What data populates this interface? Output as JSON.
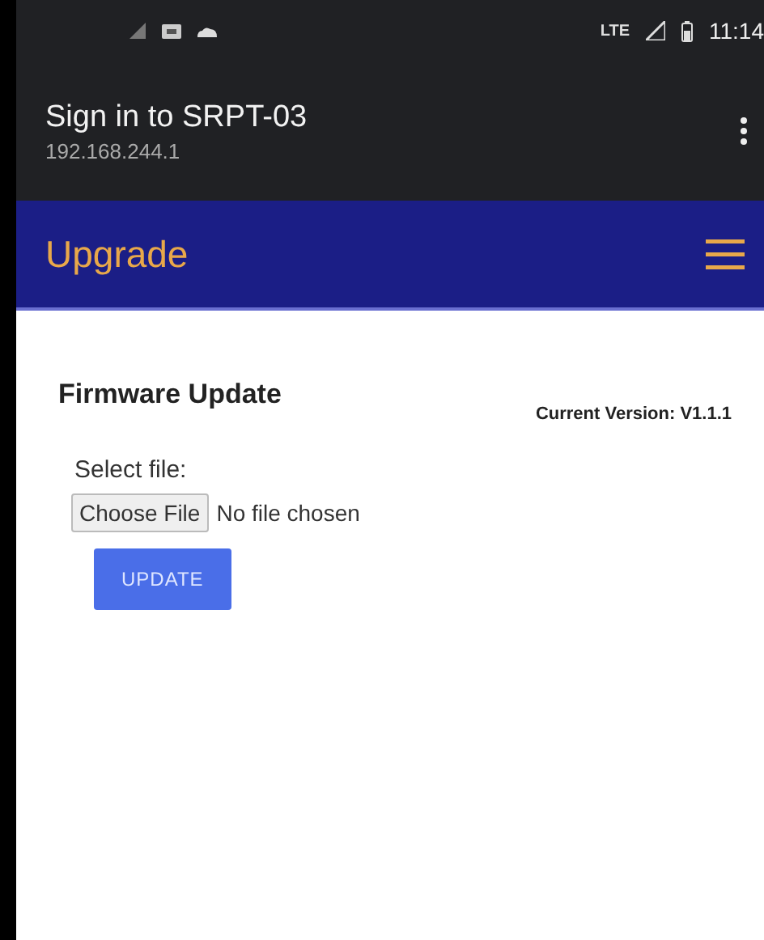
{
  "status_bar": {
    "network": "LTE",
    "time": "11:14"
  },
  "app_bar": {
    "title": "Sign in to SRPT-03",
    "subtitle": "192.168.244.1"
  },
  "nav_bar": {
    "title": "Upgrade"
  },
  "content": {
    "heading": "Firmware Update",
    "current_version": "Current Version: V1.1.1",
    "file_label": "Select file:",
    "choose_button": "Choose File",
    "file_status": "No file chosen",
    "update_button": "UPDATE"
  }
}
